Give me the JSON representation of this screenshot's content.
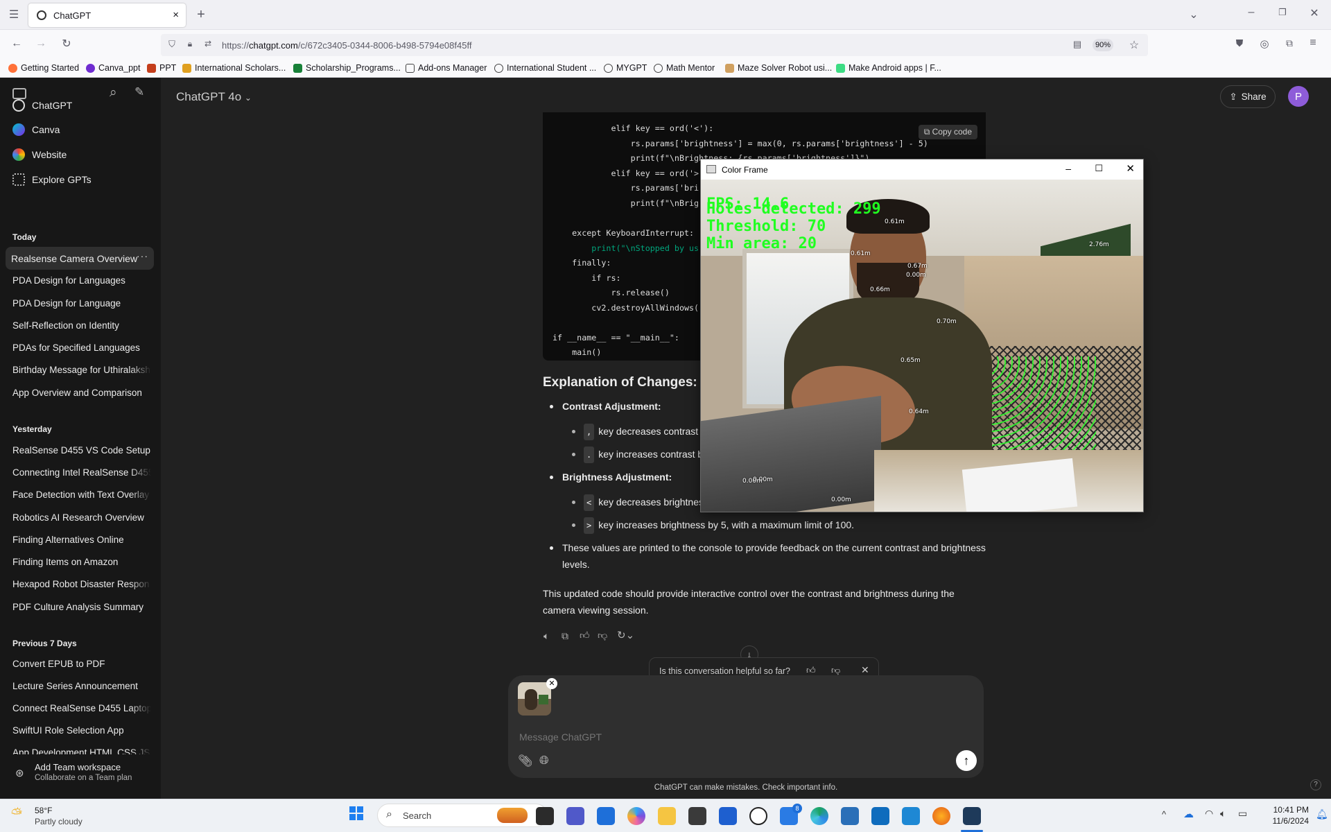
{
  "browser": {
    "tab_title": "ChatGPT",
    "url_prefix": "https://",
    "url_domain": "chatgpt.com",
    "url_path": "/c/672c3405-0344-8006-b498-5794e08f45ff",
    "zoom": "90%",
    "bookmarks": [
      "Getting Started",
      "Canva_ppt",
      "PPT",
      "International Scholars...",
      "Scholarship_Programs...",
      "Add-ons Manager",
      "International Student ...",
      "MYGPT",
      "Math Mentor",
      "Maze Solver Robot usi...",
      "Make Android apps | F..."
    ]
  },
  "sidebar": {
    "nav": [
      "ChatGPT",
      "Canva",
      "Website",
      "Explore GPTs"
    ],
    "sections": [
      {
        "title": "Today",
        "items": [
          "Realsense Camera Overview",
          "PDA Design for Languages",
          "PDA Design for Language",
          "Self-Reflection on Identity",
          "PDAs for Specified Languages",
          "Birthday Message for Uthiralaksh",
          "App Overview and Comparison"
        ]
      },
      {
        "title": "Yesterday",
        "items": [
          "RealSense D455 VS Code Setup",
          "Connecting Intel RealSense D455",
          "Face Detection with Text Overlay",
          "Robotics AI Research Overview",
          "Finding Alternatives Online",
          "Finding Items on Amazon",
          "Hexapod Robot Disaster Respon",
          "PDF Culture Analysis Summary"
        ]
      },
      {
        "title": "Previous 7 Days",
        "items": [
          "Convert EPUB to PDF",
          "Lecture Series Announcement",
          "Connect RealSense D455 Laptop",
          "SwiftUI Role Selection App",
          "App Development HTML CSS JS"
        ]
      }
    ],
    "workspace_title": "Add Team workspace",
    "workspace_sub": "Collaborate on a Team plan"
  },
  "header": {
    "model": "ChatGPT 4o",
    "share": "Share",
    "avatar": "P"
  },
  "code": {
    "copy": "Copy code",
    "lines": [
      "            elif key == ord('<'):",
      "                rs.params['brightness'] = max(0, rs.params['brightness'] - 5)",
      "                print(f\"\\nBrightness: {rs.params['brightness']}\")",
      "            elif key == ord('>",
      "                rs.params['bri",
      "                print(f\"\\nBrig",
      "",
      "    except KeyboardInterrupt:",
      "        print(\"\\nStopped by us",
      "    finally:",
      "        if rs:",
      "            rs.release()",
      "        cv2.destroyAllWindows(",
      "",
      "if __name__ == \"__main__\":",
      "    main()"
    ]
  },
  "answer": {
    "heading": "Explanation of Changes:",
    "contrast_title": "Contrast Adjustment:",
    "contrast_items": [
      {
        "key": ",",
        "text": "key decreases contrast b"
      },
      {
        "key": ".",
        "text": "key increases contrast by"
      }
    ],
    "brightness_title": "Brightness Adjustment:",
    "brightness_items": [
      {
        "key": "<",
        "text": "key decreases brightness"
      },
      {
        "key": ">",
        "text": "key increases brightness by 5, with a maximum limit of 100."
      }
    ],
    "note": "These values are printed to the console to provide feedback on the current contrast and brightness levels.",
    "summary": "This updated code should provide interactive control over the contrast and brightness during the camera viewing session."
  },
  "feedback": {
    "question": "Is this conversation helpful so far?"
  },
  "composer": {
    "placeholder": "Message ChatGPT",
    "disclaimer": "ChatGPT can make mistakes. Check important info."
  },
  "color_frame": {
    "title": "Color Frame",
    "fps": "FPS: 14.6",
    "holes": "Holes detected: 299",
    "threshold": "Threshold: 70",
    "min_area": "Min area: 20",
    "distance_labels": [
      "0.61m",
      "0.61m",
      "0.67m",
      "0.00m",
      "0.66m",
      "0.70m",
      "0.65m",
      "0.64m",
      "2.76m",
      "0.00m",
      "0.00m",
      "0.00m"
    ]
  },
  "taskbar": {
    "weather_temp": "58°F",
    "weather_desc": "Partly cloudy",
    "search": "Search",
    "time": "10:41 PM",
    "date": "11/6/2024",
    "badge": "8"
  }
}
